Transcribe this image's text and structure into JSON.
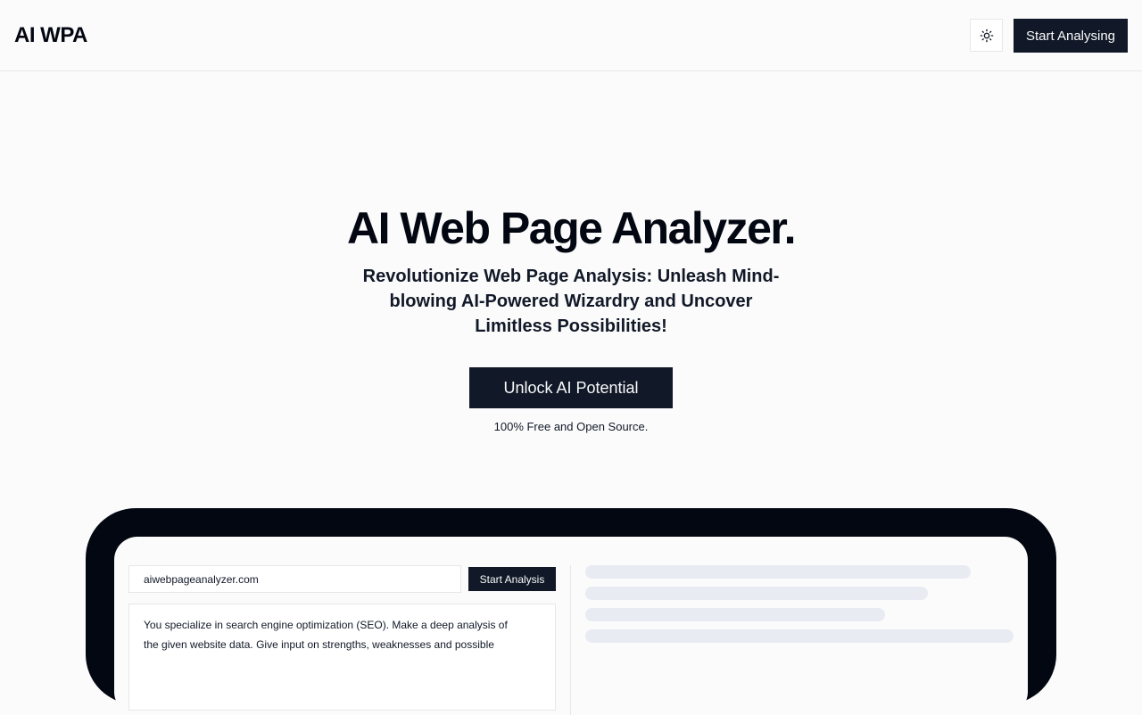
{
  "header": {
    "logo": "AI WPA",
    "theme_toggle_icon": "sun-icon",
    "start_label": "Start Analysing"
  },
  "hero": {
    "title": "AI Web Page Analyzer.",
    "subtitle_lines": [
      "Revolutionize Web Page Analysis: Unleash Mind-",
      "blowing AI-Powered Wizardry and Uncover",
      "Limitless Possibilities!"
    ],
    "cta_label": "Unlock AI Potential",
    "note": "100% Free and Open Source."
  },
  "demo": {
    "url_value": "aiwebpageanalyzer.com",
    "analysis_button": "Start Analysis",
    "prompt_lines": [
      "You specialize in search engine optimization (SEO). Make a deep analysis of",
      "the given website data. Give input on strengths, weaknesses and possible"
    ]
  },
  "colors": {
    "accent": "#111827",
    "background": "#fbfbfb",
    "device_frame": "#030712",
    "skeleton": "#e8ebf2"
  }
}
